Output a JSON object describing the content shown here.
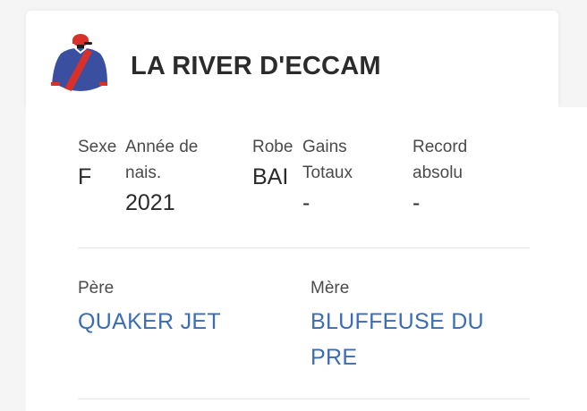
{
  "horse": {
    "name": "LA RIVER D'ECCAM"
  },
  "info": {
    "sexe": {
      "label": "Sexe",
      "value": "F"
    },
    "annee": {
      "label": "Année de nais.",
      "value": "2021"
    },
    "robe": {
      "label": "Robe",
      "value": "BAI"
    },
    "gains": {
      "label": "Gains Totaux",
      "value": "-"
    },
    "record": {
      "label": "Record absolu",
      "value": "-"
    }
  },
  "parents": {
    "pere": {
      "label": "Père",
      "value": "QUAKER JET"
    },
    "mere": {
      "label": "Mère",
      "value": "BLUFFEUSE DU PRE"
    }
  },
  "colors": {
    "link": "#3a6db3",
    "silks_body": "#3b4fa0",
    "silks_sash": "#d8312b",
    "silks_cap": "#d8312b"
  },
  "icons": {
    "silks": "jockey-silks-icon"
  }
}
